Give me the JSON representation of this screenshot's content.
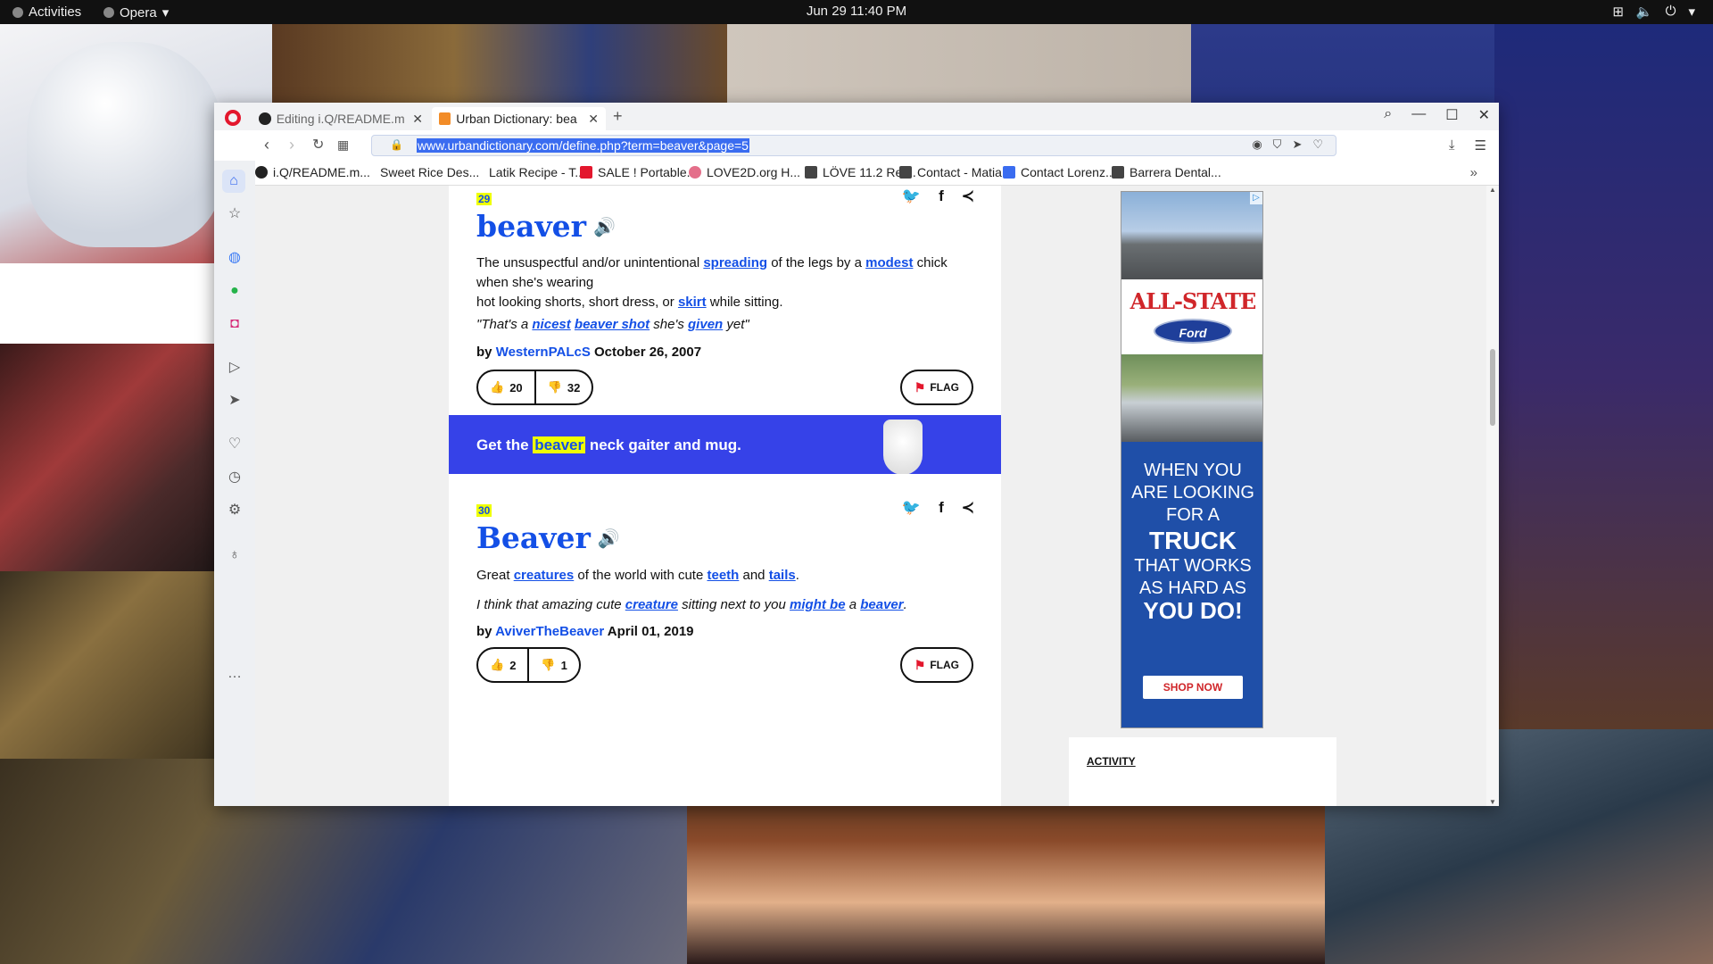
{
  "system": {
    "activities": "Activities",
    "app_name": "Opera",
    "clock": "Jun 29  11:40 PM"
  },
  "tabs": [
    {
      "title": "Editing i.Q/README.m",
      "icon": "github-icon"
    },
    {
      "title": "Urban Dictionary: bea",
      "icon": "urban-dictionary-icon"
    }
  ],
  "address_bar": {
    "url": "www.urbandictionary.com/define.php?term=beaver&page=5"
  },
  "bookmarks": [
    {
      "label": "i.Q/README.m...",
      "icon": "github-icon",
      "color": "#222222"
    },
    {
      "label": "Sweet Rice Des...",
      "icon": "none",
      "color": ""
    },
    {
      "label": "Latik Recipe - T...",
      "icon": "none",
      "color": ""
    },
    {
      "label": "SALE ! Portable...",
      "icon": "c-icon",
      "color": "#e3172d"
    },
    {
      "label": "LOVE2D.org H...",
      "icon": "love2d-icon",
      "color": "#e46f8a"
    },
    {
      "label": "LÖVE 11.2 Ref...",
      "icon": "page-icon",
      "color": "#444444"
    },
    {
      "label": "Contact - Matia...",
      "icon": "page-icon",
      "color": "#444444"
    },
    {
      "label": "Contact Lorenz...",
      "icon": "plus-icon",
      "color": "#3a6cf0"
    },
    {
      "label": "Barrera Dental...",
      "icon": "page-icon",
      "color": "#444444"
    }
  ],
  "definitions": [
    {
      "rank": "29",
      "word": "beaver",
      "meaning_parts": [
        "The unsuspectful and/or unintentional ",
        "spreading",
        " of the legs by a ",
        "modest",
        " chick when she's wearing",
        "hot looking shorts, short dress, or ",
        "skirt",
        " while sitting."
      ],
      "example_parts": [
        "\"That's a ",
        "nicest",
        " ",
        "beaver shot",
        " she's ",
        "given",
        " yet\""
      ],
      "by": "by",
      "author": "WesternPALcS",
      "date": "October 26, 2007",
      "upvotes": "20",
      "downvotes": "32",
      "flag": "FLAG"
    },
    {
      "rank": "30",
      "word": "Beaver",
      "meaning_parts": [
        "Great ",
        "creatures",
        " of the world with cute ",
        "teeth",
        " and ",
        "tails",
        "."
      ],
      "example_parts": [
        "I think that amazing cute ",
        "creature",
        " sitting next to you ",
        "might be",
        " a ",
        "beaver",
        "."
      ],
      "by": "by",
      "author": "AviverTheBeaver",
      "date": "April 01, 2019",
      "upvotes": "2",
      "downvotes": "1",
      "flag": "FLAG"
    }
  ],
  "promo": {
    "before": "Get the ",
    "highlight": "beaver",
    "after": " neck gaiter and mug."
  },
  "ad": {
    "brand": "ALL-STATE",
    "ford": "Ford",
    "line1": "WHEN YOU",
    "line2": "ARE LOOKING",
    "line3": "FOR A",
    "line4": "TRUCK",
    "line5": "THAT WORKS",
    "line6": "AS HARD AS",
    "line7": "YOU DO!",
    "cta": "SHOP NOW"
  },
  "activity": {
    "label": "ACTIVITY"
  },
  "colors": {
    "ud_blue": "#134fe6",
    "highlight": "#efff00",
    "promo_bg": "#3642e8",
    "opera_red": "#e3172d"
  }
}
